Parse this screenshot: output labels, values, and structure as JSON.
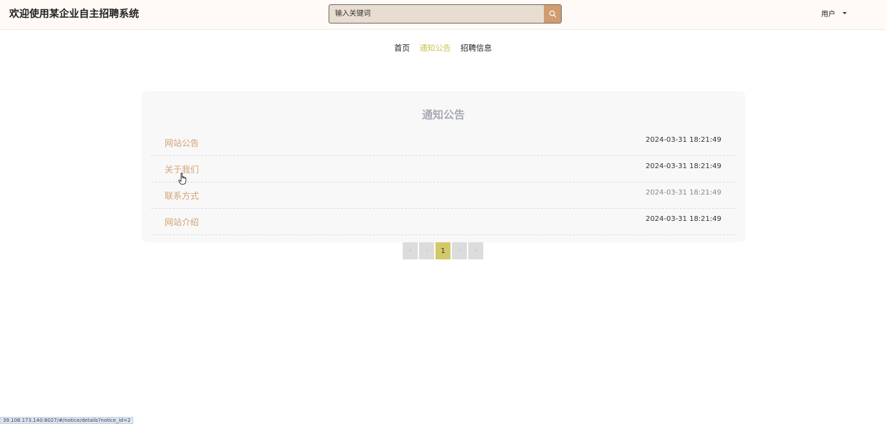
{
  "header": {
    "site_title": "欢迎使用某企业自主招聘系统",
    "search_placeholder": "输入关键词",
    "search_icon": "search-icon",
    "user_label": "用户"
  },
  "nav": {
    "items": [
      {
        "label": "首页",
        "active": false
      },
      {
        "label": "通知公告",
        "active": true
      },
      {
        "label": "招聘信息",
        "active": false
      }
    ]
  },
  "notices": {
    "title": "通知公告",
    "items": [
      {
        "title": "网站公告",
        "time": "2024-03-31 18:21:49"
      },
      {
        "title": "关于我们",
        "time": "2024-03-31 18:21:49"
      },
      {
        "title": "联系方式",
        "time": "2024-03-31 18:21:49"
      },
      {
        "title": "网站介绍",
        "time": "2024-03-31 18:21:49"
      }
    ]
  },
  "pagination": {
    "first": "«",
    "prev": "‹",
    "current_page": "1",
    "next": "›",
    "last": "»"
  },
  "status_bar": {
    "url": "39.108.173.140:8027/#/notice/details?notice_id=2"
  },
  "colors": {
    "accent": "#c6c34f",
    "notice_title": "#d4a373",
    "search_button": "#d19c6f",
    "page_current": "#d3c86a"
  }
}
